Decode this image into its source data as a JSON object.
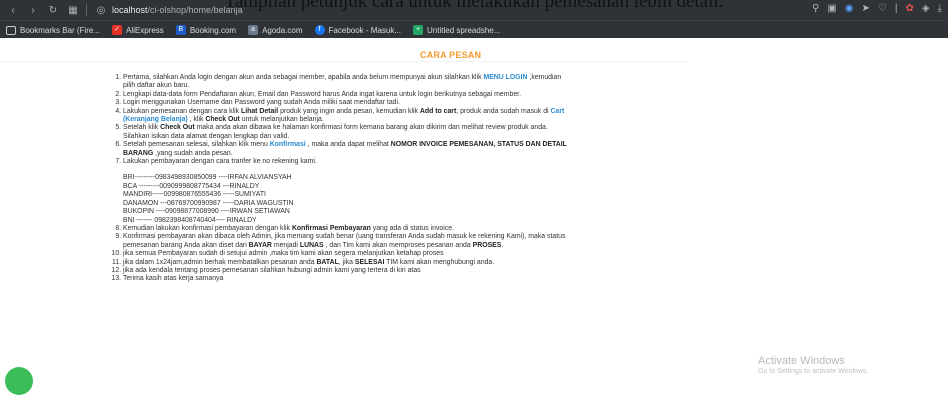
{
  "overlay_caption": "Tampilan petunjuk cara untuk melakukan pemesanan lebih detail.",
  "browser": {
    "url_host": "localhost",
    "url_path": "/ci-olshop/home/belanja"
  },
  "bookmarks": [
    {
      "label": "Bookmarks Bar (Fire...",
      "icon": "folder-icon",
      "color": "#d6dade"
    },
    {
      "label": "AliExpress",
      "icon": "aliexpress-icon",
      "color": "#e43225"
    },
    {
      "label": "Booking.com",
      "icon": "booking-icon",
      "color": "#1e5bc6"
    },
    {
      "label": "Agoda.com",
      "icon": "agoda-icon",
      "color": "#6b7a8a"
    },
    {
      "label": "Facebook - Masuk...",
      "icon": "facebook-icon",
      "color": "#1877f2"
    },
    {
      "label": "Untitled spreadshe...",
      "icon": "sheets-icon",
      "color": "#22a565"
    }
  ],
  "page": {
    "title": "CARA PESAN",
    "steps": {
      "s1": "Pertama, silahkan Anda login dengan akun anda sebagai member, apabila anda belum mempunyai akun silahkan klik",
      "s1_link": "MENU LOGIN",
      "s1_tail": ",kemudian pilih daftar akun baru.",
      "s2": "Lengkapi data-data form Pendaftaran akun, Email dan Password harus Anda ingat karena untuk login berikutnya sebagai member.",
      "s3": "Login menggunakan Username dan Password yang sudah Anda miliki saat mendaftar tadi.",
      "s4_a": "Lakukan pemesanan dengan cara klik",
      "s4_b1": "Lihat Detail",
      "s4_c": "produk yang ingin anda pesan, kemudian klik",
      "s4_b2": "Add to cart",
      "s4_d": ", produk anda sudah masuk di",
      "s4_link": "Cart (Keranjang Belanja)",
      "s4_e": ", klik",
      "s4_b3": "Check Out",
      "s4_f": "untuk melanjutkan belanja.",
      "s5_a": "Setelah klik",
      "s5_b": "Check Out",
      "s5_c": "maka anda akan dibawa ke halaman konfirmasi form kemana barang akan dikirim dan melihat review produk anda. Silahkan isikan data alamat dengan lengkap dan valid.",
      "s6_a": "Setelah pemesanan selesai, silahkan klik menu",
      "s6_link": "Konfirmasi",
      "s6_b": ", maka anda dapat melihat",
      "s6_bold": "NOMOR INVOICE PEMESANAN, STATUS DAN DETAIL BARANG",
      "s6_c": ",yang sudah anda pesan.",
      "s7": "Lakukan pembayaran dengan cara tranfer ke no rekening kami.",
      "banks": [
        "BRI---------0983498930850099 ----IRFAN ALVIANSYAH",
        "BCA ---------0090999808775434 ---RINALDY",
        "MANDIRI-----009980876555436 -----SUMIYATI",
        "DANAMON ---08769700990987 -----DARIA WAGUSTIN",
        "BUKOPIN ----09098877008990 ----IRWAN SETIAWAN",
        "BNI ------- 0982398408740404---- RINALDY"
      ],
      "s8_a": "Kemudian lakukan konfirmasi pembayaran dengan klik",
      "s8_b": "Konfirmasi Pembayaran",
      "s8_c": "yang ada di status invoice.",
      "s9_a": "Konfirmasi pembayaran akan dibaca oleh Admin, jika memang sudah benar (uang transferan Anda sudah masuk ke rekening Kami), maka status pemesanan barang Anda akan diset dari",
      "s9_b1": "BAYAR",
      "s9_c": "menjadi",
      "s9_b2": "LUNAS",
      "s9_d": ", dan Tim kami akan memproses pesanan anda",
      "s9_b3": "PROSES",
      "s9_e": ".",
      "s10": "jika semua Pembayaran sudah di setujui admin ,maka tim kami akan segera melanjutkan ketahap proses",
      "s11_a": "jika dalam 1x24jam,admin berhak membatalkan pesanan anda",
      "s11_b1": "BATAL",
      "s11_c": ", jika",
      "s11_b2": "SELESAI",
      "s11_d": "TIM kami akan menghubungi anda.",
      "s12": "jika ada kendala tentang proses pemesanan silahkan hubungi admin kami yang tertera di kiri atas",
      "s13": "Terima kasih atas kerja samanya"
    }
  },
  "watermark": {
    "title": "Activate Windows",
    "subtitle": "Go to Settings to activate Windows."
  }
}
